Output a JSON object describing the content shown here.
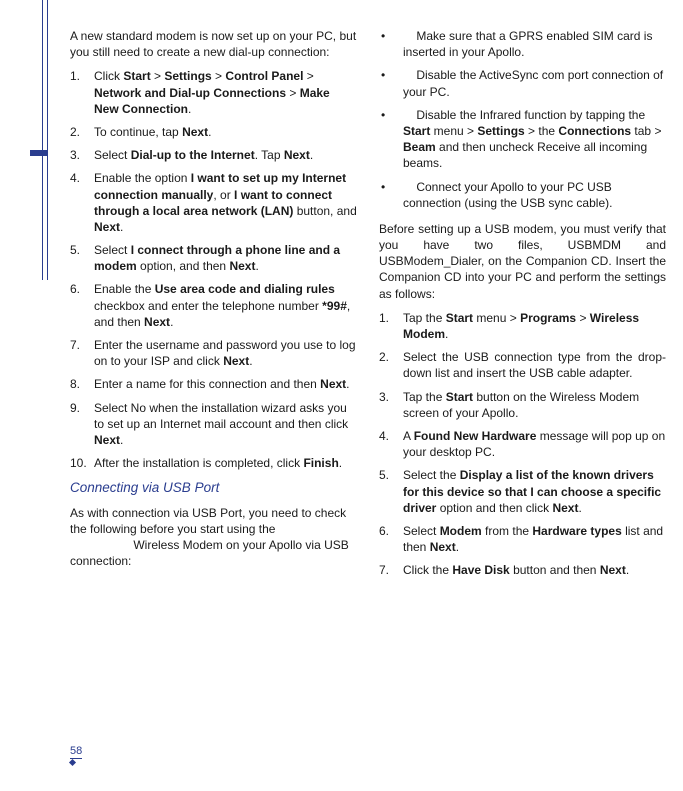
{
  "pageNumber": "58",
  "columns": {
    "left": {
      "intro": "A new standard modem is now set up on your PC, but you still need to create a new dial-up connection:",
      "list1": [
        "Click <b>Start</b> > <b>Settings</b> > <b>Control Panel</b> > <b>Network and Dial-up Connections</b> > <b>Make New Connection</b>.",
        "To continue, tap <b>Next</b>.",
        "Select <b>Dial-up to the Internet</b>. Tap <b>Next</b>.",
        "Enable the option <b>I want to set up my Internet connection manually</b>, or <b>I want to connect through a local area network (LAN)</b> button, and <b>Next</b>.",
        "Select <b>I connect through a phone line and a modem</b> option, and then <b>Next</b>.",
        "Enable the <b>Use area code and dialing rules</b> checkbox and enter the telephone number <b>*99#</b>, and then <b>Next</b>.",
        "Enter the username and password you use to log on to your ISP and click <b>Next</b>.",
        "Enter a name for this connection and then <b>Next</b>.",
        "Select No when the installation wizard asks you to set up an Internet mail account and then click <b>Next</b>.",
        "After the installation is completed, click <b>Finish</b>."
      ],
      "subhead": "Connecting via USB Port",
      "usbIntro": "As with connection via USB Port, you need to check the following before you start using the                    Wireless Modem on your Apollo via USB connection:"
    },
    "right": {
      "bullets": [
        "Make sure that a GPRS enabled SIM card is inserted in your Apollo.",
        "Disable the ActiveSync com port connection of your PC.",
        "Disable the Infrared function by tapping the <b>Start</b> menu > <b>Settings</b> > the <b>Connections</b> tab > <b>Beam</b> and then uncheck Receive all incoming beams.",
        "Connect your Apollo to your PC USB connection (using the USB sync cable)."
      ],
      "midPara": "Before setting up a USB modem, you must verify that you have two files, USBMDM and USBModem_Dialer, on the Companion CD. Insert the Companion CD into your PC and perform the settings as follows:",
      "list2": [
        "Tap the <b>Start</b> menu > <b>Programs</b> > <b>Wireless Modem</b>.",
        "Select the USB connection type from the drop-down list and insert the USB cable adapter.",
        "Tap the <b>Start</b> button on the Wireless Modem screen of your Apollo.",
        "A <b>Found New Hardware</b> message will pop up on your desktop PC.",
        "Select the <b>Display a list of the known drivers for this device so that I can choose a specific driver</b> option and then click <b>Next</b>.",
        "Select <b>Modem</b> from the <b>Hardware types</b> list and then <b>Next</b>.",
        "Click the <b>Have Disk</b> button and then <b>Next</b>."
      ]
    }
  }
}
